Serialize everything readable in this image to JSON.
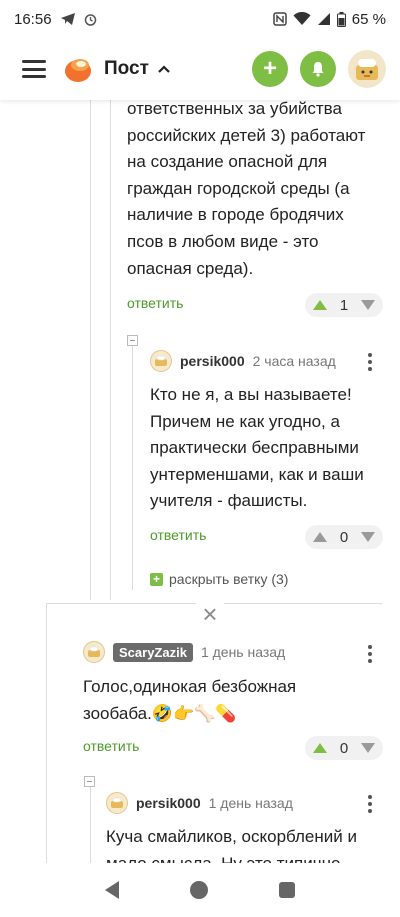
{
  "status_bar": {
    "time": "16:56",
    "battery": "65 %",
    "icons": [
      "telegram-icon",
      "alarm-icon",
      "nfc-icon",
      "wifi-icon",
      "signal-icon",
      "battery-icon"
    ]
  },
  "header": {
    "title": "Пост",
    "add_label": "+",
    "icons": [
      "menu-icon",
      "logo-icon",
      "chevron-up-icon",
      "plus-icon",
      "bell-icon",
      "avatar"
    ]
  },
  "comments": {
    "c0": {
      "text_lines": [
        "ответственных за убийства",
        "российских детей 3) работают",
        "на создание опасной для",
        "граждан городской среды (а",
        "наличие в городе бродячих",
        "псов в любом виде - это",
        "опасная среда)."
      ],
      "reply": "ответить",
      "votes": "1"
    },
    "c1": {
      "user": "persik000",
      "ago": "2 часа назад",
      "text_lines": [
        "Кто не я, а вы называете!",
        "Причем не как угодно, а",
        "практически бесправными",
        "унтерменшами, как и ваши",
        "учителя - фашисты."
      ],
      "reply": "ответить",
      "votes": "0",
      "expand": "раскрыть ветку (3)"
    },
    "c2": {
      "user": "ScaryZazik",
      "ago": "1 день назад",
      "text_lines": [
        "Голос,одинокая безбожная",
        "зообаба.🤣👉🦴💊"
      ],
      "reply": "ответить",
      "votes": "0"
    },
    "c3": {
      "user": "persik000",
      "ago": "1 день назад",
      "text_lines": [
        "Куча смайликов, оскорблений и",
        "мало смысла. Ну это типично"
      ]
    }
  },
  "colors": {
    "accent": "#7fbe45",
    "link": "#4c9a2a"
  }
}
